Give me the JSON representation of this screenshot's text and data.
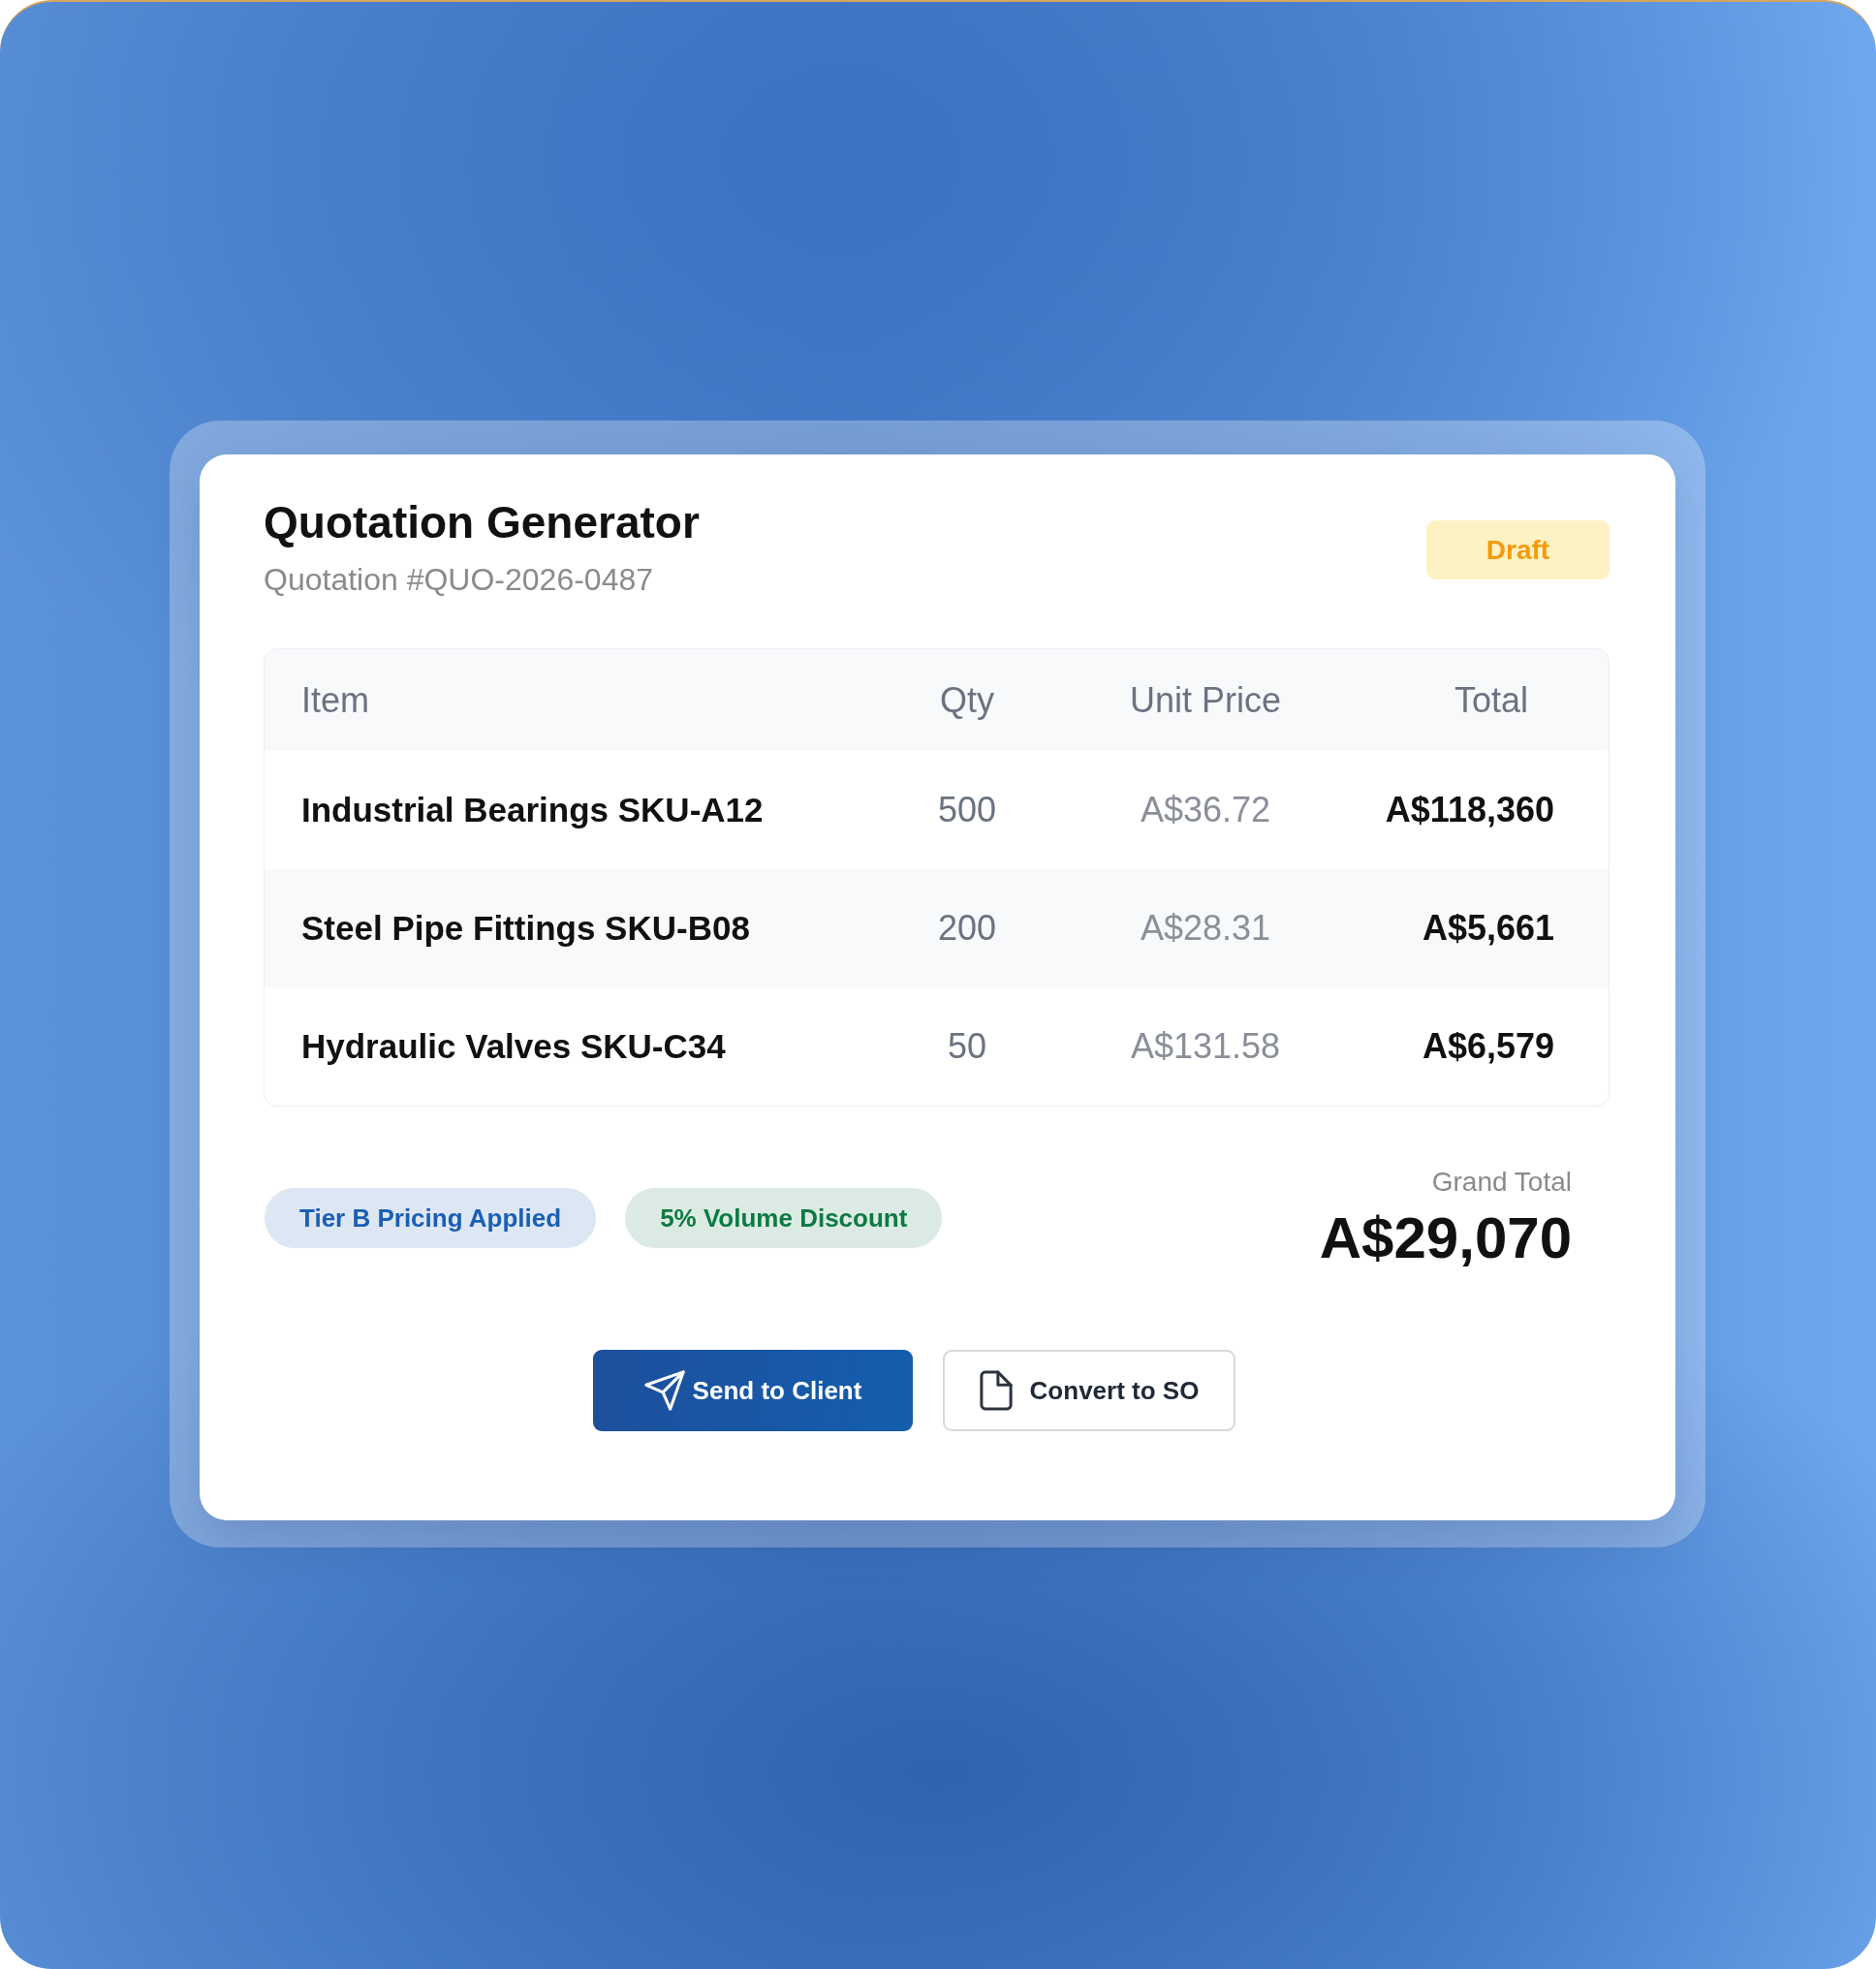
{
  "header": {
    "title": "Quotation Generator",
    "subtitle": "Quotation #QUO-2026-0487",
    "status_badge": {
      "label": "Draft"
    }
  },
  "table": {
    "columns": [
      "Item",
      "Qty",
      "Unit Price",
      "Total"
    ],
    "rows": [
      {
        "item": "Industrial Bearings SKU-A12",
        "qty": "500",
        "unit_price": "A$36.72",
        "total": "A$118,360"
      },
      {
        "item": "Steel Pipe Fittings SKU-B08",
        "qty": "200",
        "unit_price": "A$28.31",
        "total": "A$5,661"
      },
      {
        "item": "Hydraulic Valves SKU-C34",
        "qty": "50",
        "unit_price": "A$131.58",
        "total": "A$6,579"
      }
    ]
  },
  "tags": [
    {
      "label": "Tier B Pricing Applied",
      "color": "#1a5fb4"
    },
    {
      "label": "5% Volume Discount",
      "color": "#0e7a43"
    }
  ],
  "grand_total": {
    "label": "Grand Total",
    "amount": "A$29,070"
  },
  "actions": [
    {
      "label": "Send to Client",
      "kind": "primary"
    },
    {
      "label": "Convert to SO",
      "kind": "secondary"
    }
  ]
}
